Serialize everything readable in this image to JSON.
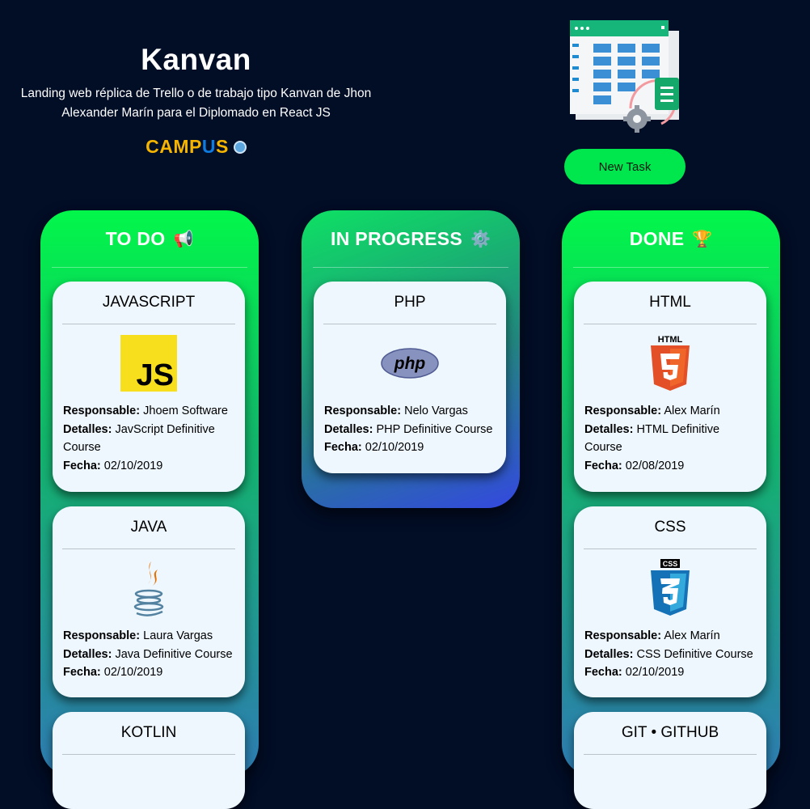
{
  "header": {
    "title": "Kanvan",
    "subtitle": "Landing web réplica de Trello o de trabajo tipo Kanvan de Jhon Alexander Marín para el Diplomado en React JS",
    "brand_prefix": "CAMP",
    "brand_u": "U",
    "brand_suffix": "S"
  },
  "new_task_label": "New Task",
  "labels": {
    "responsable": "Responsable:",
    "detalles": "Detalles:",
    "fecha": "Fecha:"
  },
  "columns": {
    "todo": {
      "title": "TO DO",
      "emoji": "📢",
      "cards": [
        {
          "title": "JAVASCRIPT",
          "responsable": "Jhoem Software",
          "detalles": "JavScript Definitive Course",
          "fecha": "02/10/2019",
          "logo": "javascript-logo"
        },
        {
          "title": "JAVA",
          "responsable": "Laura Vargas",
          "detalles": "Java Definitive Course",
          "fecha": "02/10/2019",
          "logo": "java-logo"
        },
        {
          "title": "KOTLIN",
          "logo": "kotlin-logo"
        }
      ]
    },
    "in_progress": {
      "title": "IN PROGRESS",
      "emoji": "⚙️",
      "cards": [
        {
          "title": "PHP",
          "responsable": "Nelo Vargas",
          "detalles": "PHP Definitive Course",
          "fecha": "02/10/2019",
          "logo": "php-logo"
        }
      ]
    },
    "done": {
      "title": "DONE",
      "emoji": "🏆",
      "cards": [
        {
          "title": "HTML",
          "responsable": "Alex Marín",
          "detalles": "HTML Definitive Course",
          "fecha": "02/08/2019",
          "logo": "html5-logo"
        },
        {
          "title": "CSS",
          "responsable": "Alex Marín",
          "detalles": "CSS Definitive Course",
          "fecha": "02/10/2019",
          "logo": "css3-logo"
        },
        {
          "title": "GIT • GITHUB",
          "logo": "git-logo"
        }
      ]
    }
  },
  "colors": {
    "background": "#020d26",
    "accent_green": "#00e64d",
    "card_bg": "#eef7fe",
    "brand_yellow": "#f4b400",
    "brand_blue": "#0d7be0"
  }
}
